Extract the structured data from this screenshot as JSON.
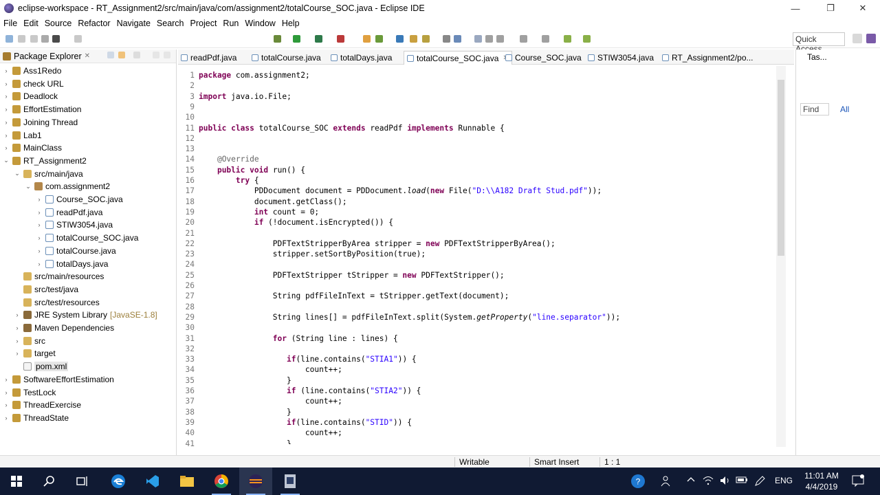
{
  "window": {
    "title": "eclipse-workspace - RT_Assignment2/src/main/java/com/assignment2/totalCourse_SOC.java - Eclipse IDE",
    "minimize": "—",
    "maximize": "❐",
    "close": "✕"
  },
  "menu": [
    "File",
    "Edit",
    "Source",
    "Refactor",
    "Navigate",
    "Search",
    "Project",
    "Run",
    "Window",
    "Help"
  ],
  "quick_access": "Quick Access",
  "package_explorer": {
    "title": "Package Explorer",
    "close": "✕",
    "items": [
      {
        "label": "Ass1Redo",
        "twisty": "›",
        "icon": "project-icon"
      },
      {
        "label": "check URL",
        "twisty": "›",
        "icon": "project-icon"
      },
      {
        "label": "Deadlock",
        "twisty": "›",
        "icon": "project-icon"
      },
      {
        "label": "EffortEstimation",
        "twisty": "›",
        "icon": "project-icon"
      },
      {
        "label": "Joining Thread",
        "twisty": "›",
        "icon": "project-icon"
      },
      {
        "label": "Lab1",
        "twisty": "›",
        "icon": "project-icon"
      },
      {
        "label": "MainClass",
        "twisty": "›",
        "icon": "project-icon"
      },
      {
        "label": "RT_Assignment2",
        "twisty": "⌄",
        "icon": "project-icon"
      },
      {
        "label": "src/main/java",
        "twisty": "⌄",
        "icon": "source-folder-icon"
      },
      {
        "label": "com.assignment2",
        "twisty": "⌄",
        "icon": "package-icon"
      },
      {
        "label": "Course_SOC.java",
        "twisty": "›",
        "icon": "java-file-icon"
      },
      {
        "label": "readPdf.java",
        "twisty": "›",
        "icon": "java-file-icon"
      },
      {
        "label": "STIW3054.java",
        "twisty": "›",
        "icon": "java-file-icon"
      },
      {
        "label": "totalCourse_SOC.java",
        "twisty": "›",
        "icon": "java-file-icon"
      },
      {
        "label": "totalCourse.java",
        "twisty": "›",
        "icon": "java-file-icon"
      },
      {
        "label": "totalDays.java",
        "twisty": "›",
        "icon": "java-file-icon"
      },
      {
        "label": "src/main/resources",
        "twisty": "",
        "icon": "source-folder-icon"
      },
      {
        "label": "src/test/java",
        "twisty": "",
        "icon": "source-folder-icon"
      },
      {
        "label": "src/test/resources",
        "twisty": "",
        "icon": "source-folder-icon"
      },
      {
        "label": "JRE System Library",
        "qualifier": "[JavaSE-1.8]",
        "twisty": "›",
        "icon": "library-icon"
      },
      {
        "label": "Maven Dependencies",
        "twisty": "›",
        "icon": "library-icon"
      },
      {
        "label": "src",
        "twisty": "›",
        "icon": "folder-icon"
      },
      {
        "label": "target",
        "twisty": "›",
        "icon": "folder-icon"
      },
      {
        "label": "pom.xml",
        "twisty": "",
        "icon": "maven-pom-icon"
      },
      {
        "label": "SoftwareEffortEstimation",
        "twisty": "›",
        "icon": "project-icon"
      },
      {
        "label": "TestLock",
        "twisty": "›",
        "icon": "project-icon"
      },
      {
        "label": "ThreadExercise",
        "twisty": "›",
        "icon": "project-icon"
      },
      {
        "label": "ThreadState",
        "twisty": "›",
        "icon": "project-icon"
      }
    ]
  },
  "editor": {
    "tabs": [
      {
        "label": "readPdf.java",
        "active": false
      },
      {
        "label": "totalCourse.java",
        "active": false
      },
      {
        "label": "totalDays.java",
        "active": false
      },
      {
        "label": "totalCourse_SOC.java",
        "active": true
      },
      {
        "label": "Course_SOC.java",
        "active": false
      },
      {
        "label": "STIW3054.java",
        "active": false
      },
      {
        "label": "RT_Assignment2/po...",
        "active": false
      }
    ],
    "lines": [
      {
        "n": "1",
        "code": "package com.assignment2;"
      },
      {
        "n": "2",
        "code": ""
      },
      {
        "n": "3",
        "code": "import java.io.File;"
      },
      {
        "n": "9",
        "code": ""
      },
      {
        "n": "10",
        "code": ""
      },
      {
        "n": "11",
        "code": "public class totalCourse_SOC extends readPdf implements Runnable {"
      },
      {
        "n": "12",
        "code": ""
      },
      {
        "n": "13",
        "code": ""
      },
      {
        "n": "14",
        "code": "    @Override"
      },
      {
        "n": "15",
        "code": "    public void run() {"
      },
      {
        "n": "16",
        "code": "        try {"
      },
      {
        "n": "17",
        "code": "            PDDocument document = PDDocument.load(new File(\"D:\\\\A182 Draft Stud.pdf\"));"
      },
      {
        "n": "18",
        "code": "            document.getClass();"
      },
      {
        "n": "19",
        "code": "            int count = 0;"
      },
      {
        "n": "20",
        "code": "            if (!document.isEncrypted()) {"
      },
      {
        "n": "21",
        "code": ""
      },
      {
        "n": "22",
        "code": "                PDFTextStripperByArea stripper = new PDFTextStripperByArea();"
      },
      {
        "n": "23",
        "code": "                stripper.setSortByPosition(true);"
      },
      {
        "n": "24",
        "code": ""
      },
      {
        "n": "25",
        "code": "                PDFTextStripper tStripper = new PDFTextStripper();"
      },
      {
        "n": "26",
        "code": ""
      },
      {
        "n": "27",
        "code": "                String pdfFileInText = tStripper.getText(document);"
      },
      {
        "n": "28",
        "code": ""
      },
      {
        "n": "29",
        "code": "                String lines[] = pdfFileInText.split(System.getProperty(\"line.separator\"));"
      },
      {
        "n": "30",
        "code": ""
      },
      {
        "n": "31",
        "code": "                for (String line : lines) {"
      },
      {
        "n": "32",
        "code": ""
      },
      {
        "n": "33",
        "code": "                   if(line.contains(\"STIA1\")) {"
      },
      {
        "n": "34",
        "code": "                       count++;"
      },
      {
        "n": "35",
        "code": "                   }"
      },
      {
        "n": "36",
        "code": "                   if (line.contains(\"STIA2\")) {"
      },
      {
        "n": "37",
        "code": "                       count++;"
      },
      {
        "n": "38",
        "code": "                   }"
      },
      {
        "n": "39",
        "code": "                   if(line.contains(\"STID\")) {"
      },
      {
        "n": "40",
        "code": "                       count++;"
      },
      {
        "n": "41",
        "code": "                   }"
      }
    ]
  },
  "tasks_view": {
    "title": "Tas...",
    "find": "Find",
    "all": "All"
  },
  "status": {
    "writable": "Writable",
    "insert_mode": "Smart Insert",
    "position": "1 : 1"
  },
  "taskbar": {
    "language": "ENG",
    "time": "11:01 AM",
    "date": "4/4/2019"
  },
  "colors": {
    "keyword": "#7f0055",
    "string": "#2a00ff",
    "annotation": "#646464",
    "taskbar": "#101a33"
  }
}
